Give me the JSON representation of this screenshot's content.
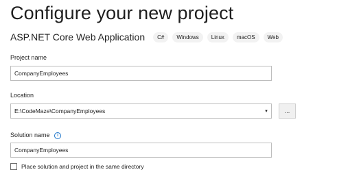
{
  "header": {
    "title": "Configure your new project",
    "project_type": "ASP.NET Core Web Application",
    "tags": [
      "C#",
      "Windows",
      "Linux",
      "macOS",
      "Web"
    ]
  },
  "form": {
    "project_name_label": "Project name",
    "project_name_value": "CompanyEmployees",
    "location_label": "Location",
    "location_value": "E:\\CodeMaze\\CompanyEmployees",
    "browse_label": "...",
    "solution_name_label": "Solution name",
    "solution_name_value": "CompanyEmployees",
    "same_directory_label": "Place solution and project in the same directory",
    "same_directory_checked": false
  },
  "icons": {
    "info": "info-icon",
    "dropdown": "chevron-down-icon"
  },
  "colors": {
    "info_icon": "#1a73c9",
    "field_border": "#bdbdbd"
  }
}
